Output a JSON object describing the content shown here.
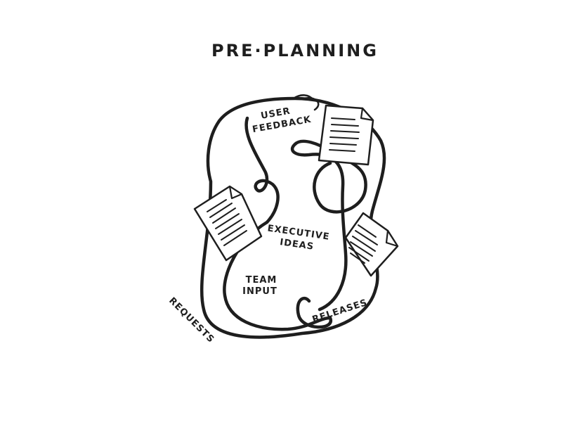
{
  "title": "PRE·PLANNING",
  "labels": {
    "user_feedback_line1": "USER",
    "user_feedback_line2": "FEEDBACK",
    "executive_ideas_line1": "EXECUTIVE",
    "executive_ideas_line2": "IDEAS",
    "team_input_line1": "TEAM",
    "team_input_line2": "INPUT",
    "requests": "REQUESTS",
    "releases": "RELEASES"
  },
  "colors": {
    "ink": "#1e1e1e",
    "background": "#ffffff"
  }
}
